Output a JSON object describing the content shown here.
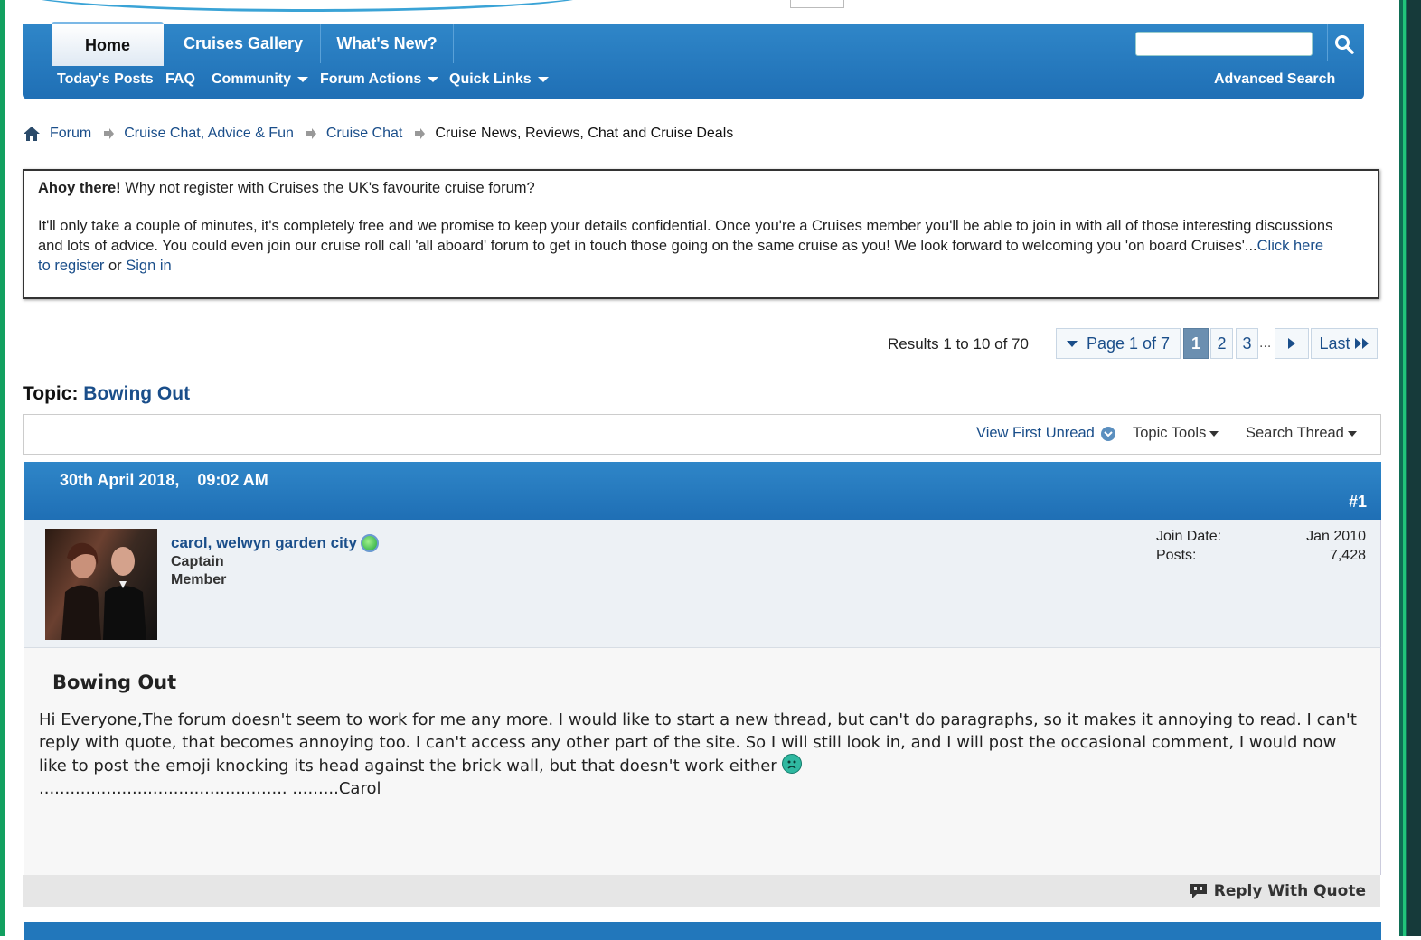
{
  "nav": {
    "tabs": [
      "Home",
      "Cruises Gallery",
      "What's New?"
    ],
    "subnav": [
      "Today's Posts",
      "FAQ",
      "Community",
      "Forum Actions",
      "Quick Links"
    ],
    "advanced_search": "Advanced Search",
    "search_placeholder": ""
  },
  "breadcrumb": [
    "Forum",
    "Cruise Chat, Advice & Fun",
    "Cruise Chat",
    "Cruise News, Reviews, Chat and Cruise Deals"
  ],
  "register": {
    "bold": "Ahoy there!",
    "line1_rest": " Why not register with Cruises the UK's favourite cruise forum?",
    "para": "It'll only take a couple of minutes, it's completely free and we promise to keep your details confidential. Once you're a Cruises member you'll be able to join in with all of those interesting discussions and lots of advice. You could even join our cruise roll call 'all aboard' forum to get in touch those going on the same cruise as you! We look forward to welcoming you 'on board Cruises'...",
    "register_link": "Click here to register",
    "or": " or ",
    "signin_link": "Sign in"
  },
  "pagination": {
    "results": "Results 1 to 10 of 70",
    "page_of": "Page 1 of 7",
    "pages": [
      "1",
      "2",
      "3"
    ],
    "ellipsis": "...",
    "last": "Last"
  },
  "topic": {
    "prefix": "Topic:",
    "title": "Bowing Out"
  },
  "tools": {
    "view_first_unread": "View First Unread",
    "topic_tools": "Topic Tools",
    "search_thread": "Search Thread"
  },
  "post": {
    "date": "30th April 2018,",
    "time": "09:02 AM",
    "number": "#1",
    "username": "carol, welwyn garden city",
    "rank1": "Captain",
    "rank2": "Member",
    "join_label": "Join Date:",
    "join_value": "Jan 2010",
    "posts_label": "Posts:",
    "posts_value": "7,428",
    "title": "Bowing Out",
    "body": "Hi Everyone,The forum doesn't seem to work for me any more. I would like to start a new thread, but can't do paragraphs, so it makes it annoying to read. I can't reply with quote, that becomes annoying too. I can't access any other part of the site. So I will still look in, and I will post the occasional comment, I would now like to post the emoji knocking its head against the brick wall, but that doesn't work either",
    "body_tail": "................................................ .........Carol",
    "reply_quote": "Reply With Quote"
  }
}
